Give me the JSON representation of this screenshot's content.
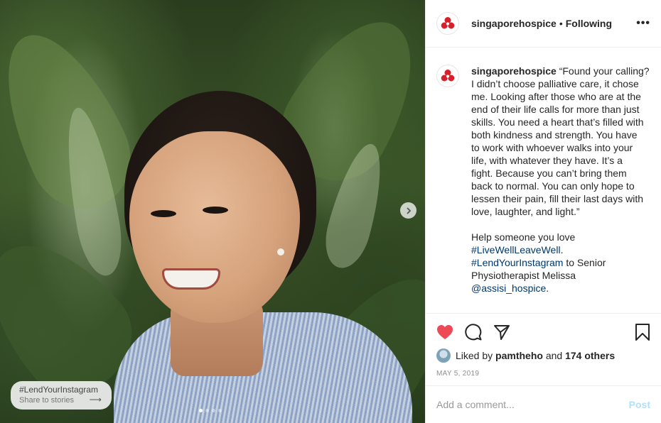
{
  "photo": {
    "tag_title": "#LendYourInstagram",
    "tag_subtitle": "Share to stories",
    "carousel_dots": 4,
    "active_dot": 1
  },
  "header": {
    "username": "singaporehospice",
    "separator": "•",
    "follow_status": "Following",
    "more": "•••"
  },
  "caption": {
    "username": "singaporehospice",
    "lines": [
      "“Found your calling?",
      "I didn’t choose palliative care, it chose",
      "me. Looking after those who are at the",
      "end of their life calls for more than just",
      "skills. You need a heart that’s filled with",
      "both kindness and strength. You have",
      "to work with whoever walks into your",
      "life, with whatever they have. It’s a",
      "fight. Because you can’t bring them",
      "back to normal. You can only hope to",
      "lessen their pain, fill their last days with",
      "love, laughter, and light.”"
    ],
    "help_line": "Help someone you love",
    "hashtag1": "#LiveWellLeaveWell",
    "hashtag1_suffix": ".",
    "hashtag2": "#LendYourInstagram",
    "hashtag2_suffix": " to Senior",
    "role_line": "Physiotherapist Melissa",
    "mention": "@assisi_hospice",
    "mention_suffix": "."
  },
  "likes": {
    "prefix": "Liked by",
    "user": "pamtheho",
    "middle": "and",
    "others": "174 others"
  },
  "date": "MAY 5, 2019",
  "comment": {
    "placeholder": "Add a comment...",
    "post_label": "Post"
  },
  "colors": {
    "brand_red": "#d6202a",
    "heart_red": "#ed4956",
    "link_blue": "#00376b",
    "post_disabled": "#b2dffc"
  },
  "icons": [
    "next-arrow-icon",
    "heart-icon",
    "comment-icon",
    "share-icon",
    "bookmark-icon",
    "hospice-logo-icon"
  ]
}
